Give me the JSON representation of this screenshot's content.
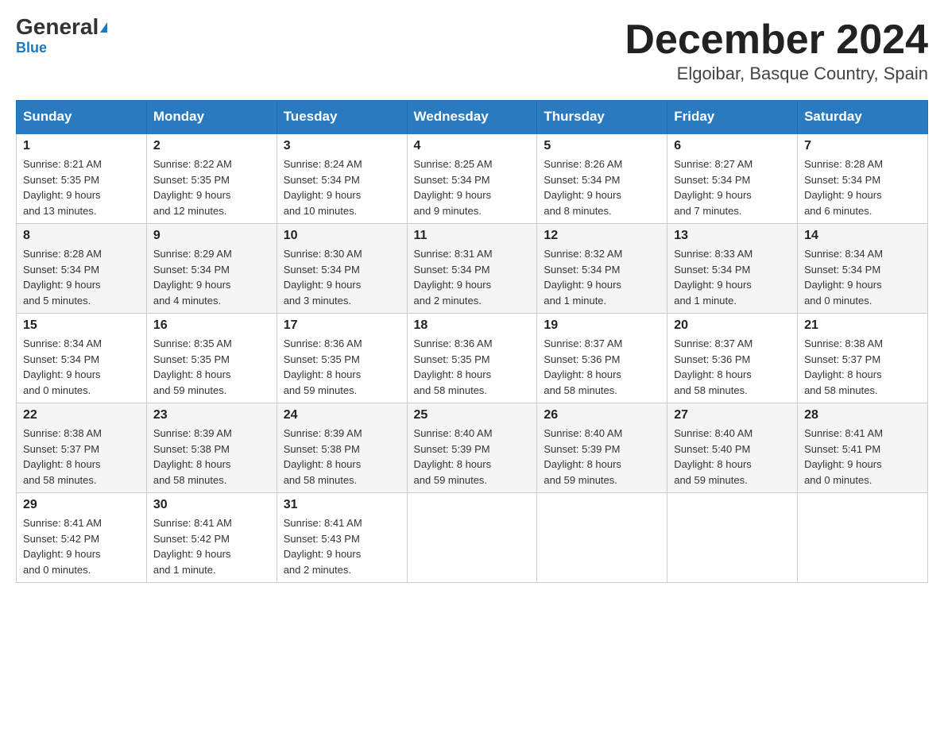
{
  "header": {
    "logo_general": "General",
    "logo_blue": "Blue",
    "title": "December 2024",
    "subtitle": "Elgoibar, Basque Country, Spain"
  },
  "columns": [
    "Sunday",
    "Monday",
    "Tuesday",
    "Wednesday",
    "Thursday",
    "Friday",
    "Saturday"
  ],
  "weeks": [
    {
      "days": [
        {
          "number": "1",
          "sunrise": "Sunrise: 8:21 AM",
          "sunset": "Sunset: 5:35 PM",
          "daylight": "Daylight: 9 hours",
          "daylight2": "and 13 minutes."
        },
        {
          "number": "2",
          "sunrise": "Sunrise: 8:22 AM",
          "sunset": "Sunset: 5:35 PM",
          "daylight": "Daylight: 9 hours",
          "daylight2": "and 12 minutes."
        },
        {
          "number": "3",
          "sunrise": "Sunrise: 8:24 AM",
          "sunset": "Sunset: 5:34 PM",
          "daylight": "Daylight: 9 hours",
          "daylight2": "and 10 minutes."
        },
        {
          "number": "4",
          "sunrise": "Sunrise: 8:25 AM",
          "sunset": "Sunset: 5:34 PM",
          "daylight": "Daylight: 9 hours",
          "daylight2": "and 9 minutes."
        },
        {
          "number": "5",
          "sunrise": "Sunrise: 8:26 AM",
          "sunset": "Sunset: 5:34 PM",
          "daylight": "Daylight: 9 hours",
          "daylight2": "and 8 minutes."
        },
        {
          "number": "6",
          "sunrise": "Sunrise: 8:27 AM",
          "sunset": "Sunset: 5:34 PM",
          "daylight": "Daylight: 9 hours",
          "daylight2": "and 7 minutes."
        },
        {
          "number": "7",
          "sunrise": "Sunrise: 8:28 AM",
          "sunset": "Sunset: 5:34 PM",
          "daylight": "Daylight: 9 hours",
          "daylight2": "and 6 minutes."
        }
      ]
    },
    {
      "days": [
        {
          "number": "8",
          "sunrise": "Sunrise: 8:28 AM",
          "sunset": "Sunset: 5:34 PM",
          "daylight": "Daylight: 9 hours",
          "daylight2": "and 5 minutes."
        },
        {
          "number": "9",
          "sunrise": "Sunrise: 8:29 AM",
          "sunset": "Sunset: 5:34 PM",
          "daylight": "Daylight: 9 hours",
          "daylight2": "and 4 minutes."
        },
        {
          "number": "10",
          "sunrise": "Sunrise: 8:30 AM",
          "sunset": "Sunset: 5:34 PM",
          "daylight": "Daylight: 9 hours",
          "daylight2": "and 3 minutes."
        },
        {
          "number": "11",
          "sunrise": "Sunrise: 8:31 AM",
          "sunset": "Sunset: 5:34 PM",
          "daylight": "Daylight: 9 hours",
          "daylight2": "and 2 minutes."
        },
        {
          "number": "12",
          "sunrise": "Sunrise: 8:32 AM",
          "sunset": "Sunset: 5:34 PM",
          "daylight": "Daylight: 9 hours",
          "daylight2": "and 1 minute."
        },
        {
          "number": "13",
          "sunrise": "Sunrise: 8:33 AM",
          "sunset": "Sunset: 5:34 PM",
          "daylight": "Daylight: 9 hours",
          "daylight2": "and 1 minute."
        },
        {
          "number": "14",
          "sunrise": "Sunrise: 8:34 AM",
          "sunset": "Sunset: 5:34 PM",
          "daylight": "Daylight: 9 hours",
          "daylight2": "and 0 minutes."
        }
      ]
    },
    {
      "days": [
        {
          "number": "15",
          "sunrise": "Sunrise: 8:34 AM",
          "sunset": "Sunset: 5:34 PM",
          "daylight": "Daylight: 9 hours",
          "daylight2": "and 0 minutes."
        },
        {
          "number": "16",
          "sunrise": "Sunrise: 8:35 AM",
          "sunset": "Sunset: 5:35 PM",
          "daylight": "Daylight: 8 hours",
          "daylight2": "and 59 minutes."
        },
        {
          "number": "17",
          "sunrise": "Sunrise: 8:36 AM",
          "sunset": "Sunset: 5:35 PM",
          "daylight": "Daylight: 8 hours",
          "daylight2": "and 59 minutes."
        },
        {
          "number": "18",
          "sunrise": "Sunrise: 8:36 AM",
          "sunset": "Sunset: 5:35 PM",
          "daylight": "Daylight: 8 hours",
          "daylight2": "and 58 minutes."
        },
        {
          "number": "19",
          "sunrise": "Sunrise: 8:37 AM",
          "sunset": "Sunset: 5:36 PM",
          "daylight": "Daylight: 8 hours",
          "daylight2": "and 58 minutes."
        },
        {
          "number": "20",
          "sunrise": "Sunrise: 8:37 AM",
          "sunset": "Sunset: 5:36 PM",
          "daylight": "Daylight: 8 hours",
          "daylight2": "and 58 minutes."
        },
        {
          "number": "21",
          "sunrise": "Sunrise: 8:38 AM",
          "sunset": "Sunset: 5:37 PM",
          "daylight": "Daylight: 8 hours",
          "daylight2": "and 58 minutes."
        }
      ]
    },
    {
      "days": [
        {
          "number": "22",
          "sunrise": "Sunrise: 8:38 AM",
          "sunset": "Sunset: 5:37 PM",
          "daylight": "Daylight: 8 hours",
          "daylight2": "and 58 minutes."
        },
        {
          "number": "23",
          "sunrise": "Sunrise: 8:39 AM",
          "sunset": "Sunset: 5:38 PM",
          "daylight": "Daylight: 8 hours",
          "daylight2": "and 58 minutes."
        },
        {
          "number": "24",
          "sunrise": "Sunrise: 8:39 AM",
          "sunset": "Sunset: 5:38 PM",
          "daylight": "Daylight: 8 hours",
          "daylight2": "and 58 minutes."
        },
        {
          "number": "25",
          "sunrise": "Sunrise: 8:40 AM",
          "sunset": "Sunset: 5:39 PM",
          "daylight": "Daylight: 8 hours",
          "daylight2": "and 59 minutes."
        },
        {
          "number": "26",
          "sunrise": "Sunrise: 8:40 AM",
          "sunset": "Sunset: 5:39 PM",
          "daylight": "Daylight: 8 hours",
          "daylight2": "and 59 minutes."
        },
        {
          "number": "27",
          "sunrise": "Sunrise: 8:40 AM",
          "sunset": "Sunset: 5:40 PM",
          "daylight": "Daylight: 8 hours",
          "daylight2": "and 59 minutes."
        },
        {
          "number": "28",
          "sunrise": "Sunrise: 8:41 AM",
          "sunset": "Sunset: 5:41 PM",
          "daylight": "Daylight: 9 hours",
          "daylight2": "and 0 minutes."
        }
      ]
    },
    {
      "days": [
        {
          "number": "29",
          "sunrise": "Sunrise: 8:41 AM",
          "sunset": "Sunset: 5:42 PM",
          "daylight": "Daylight: 9 hours",
          "daylight2": "and 0 minutes."
        },
        {
          "number": "30",
          "sunrise": "Sunrise: 8:41 AM",
          "sunset": "Sunset: 5:42 PM",
          "daylight": "Daylight: 9 hours",
          "daylight2": "and 1 minute."
        },
        {
          "number": "31",
          "sunrise": "Sunrise: 8:41 AM",
          "sunset": "Sunset: 5:43 PM",
          "daylight": "Daylight: 9 hours",
          "daylight2": "and 2 minutes."
        },
        {
          "number": "",
          "sunrise": "",
          "sunset": "",
          "daylight": "",
          "daylight2": ""
        },
        {
          "number": "",
          "sunrise": "",
          "sunset": "",
          "daylight": "",
          "daylight2": ""
        },
        {
          "number": "",
          "sunrise": "",
          "sunset": "",
          "daylight": "",
          "daylight2": ""
        },
        {
          "number": "",
          "sunrise": "",
          "sunset": "",
          "daylight": "",
          "daylight2": ""
        }
      ]
    }
  ]
}
